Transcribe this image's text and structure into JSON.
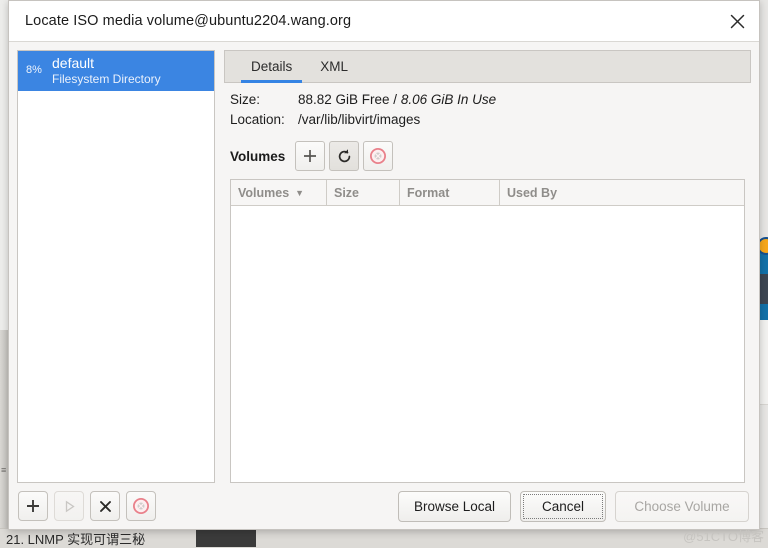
{
  "dialog": {
    "title": "Locate ISO media volume@ubuntu2204.wang.org",
    "close_icon": "close-icon"
  },
  "sidebar": {
    "pools": [
      {
        "usage": "8%",
        "name": "default",
        "type": "Filesystem Directory",
        "selected": true
      }
    ],
    "toolbar": {
      "add_label": "+",
      "start_label": "▷",
      "stop_label": "✕",
      "delete_label": "⊗"
    }
  },
  "tabs": [
    {
      "label": "Details",
      "active": true
    },
    {
      "label": "XML",
      "active": false
    }
  ],
  "details": {
    "size_label": "Size:",
    "size_free": "88.82 GiB Free",
    "size_separator": " / ",
    "size_inuse": "8.06 GiB In Use",
    "location_label": "Location:",
    "location_value": "/var/lib/libvirt/images"
  },
  "volumes": {
    "section_label": "Volumes",
    "toolbar": {
      "new_volume": "add-volume-icon",
      "refresh": "refresh-icon",
      "delete": "delete-volume-icon"
    },
    "columns": [
      {
        "label": "Volumes",
        "sorted": true,
        "caret": "▼"
      },
      {
        "label": "Size",
        "sorted": false,
        "caret": ""
      },
      {
        "label": "Format",
        "sorted": false,
        "caret": ""
      },
      {
        "label": "Used By",
        "sorted": false,
        "caret": ""
      }
    ],
    "rows": []
  },
  "footer": {
    "browse_local": "Browse Local",
    "cancel": "Cancel",
    "choose_volume": "Choose Volume"
  },
  "background": {
    "bottom_text": "21. LNMP 实现可谓三秘",
    "watermark": "@51CTO博客"
  },
  "colors": {
    "accent_blue": "#3584e4",
    "selection_blue": "#3b85e2",
    "title_accent": "#1b6ea8",
    "delete_red": "#e9808a"
  }
}
